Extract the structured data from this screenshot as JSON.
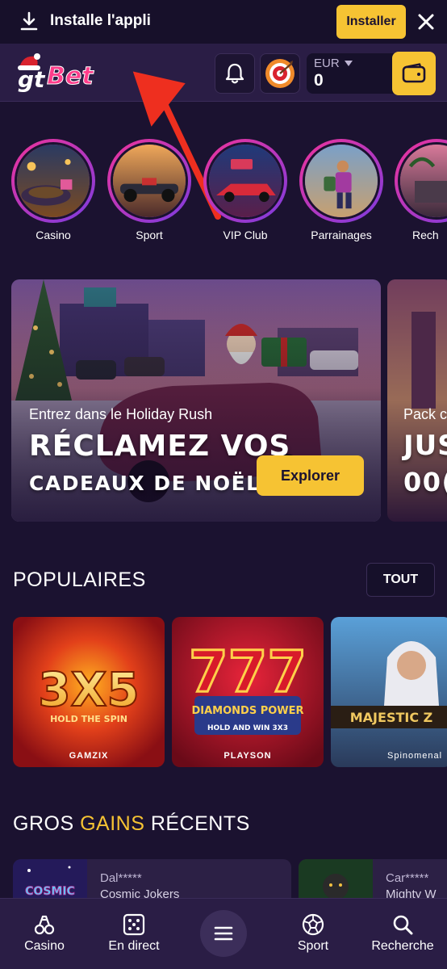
{
  "app_banner": {
    "text": "Installe l'appli",
    "install_label": "Installer",
    "icons": [
      "download-icon",
      "close-icon"
    ]
  },
  "header": {
    "logo_text": "gtBet",
    "currency": "EUR",
    "balance": "0",
    "icons": [
      "bell-icon",
      "target-icon",
      "wallet-icon"
    ]
  },
  "stories": [
    {
      "label": "Casino"
    },
    {
      "label": "Sport"
    },
    {
      "label": "VIP Club"
    },
    {
      "label": "Parrainages"
    },
    {
      "label": "Rech"
    }
  ],
  "promos": [
    {
      "subtitle": "Entrez dans le Holiday Rush",
      "headline1": "RÉCLAMEZ VOS",
      "headline2": "CADEAUX DE NOËL",
      "button": "Explorer"
    },
    {
      "subtitle": "Pack c",
      "headline1": "JUS",
      "headline2": "00("
    }
  ],
  "popular": {
    "title": "POPULAIRES",
    "all_label": "TOUT",
    "games": [
      {
        "title_line1": "3X5",
        "title_line2": "HOLD THE SPIN",
        "provider": "GAMZIX"
      },
      {
        "title_line1": "777",
        "title_line2": "DIAMONDS POWER",
        "title_line3": "HOLD AND WIN 3X3",
        "provider": "PLAYSON"
      },
      {
        "title_line1": "MAJESTIC Z",
        "provider": "Spinomenal"
      }
    ]
  },
  "recent_wins": {
    "title_part1": "GROS",
    "title_accent": "GAINS",
    "title_part2": "RÉCENTS",
    "items": [
      {
        "user": "Dal*****",
        "game": "Cosmic Jokers",
        "thumb_text": "COSMIC"
      },
      {
        "user": "Car*****",
        "game": "Mighty W"
      }
    ]
  },
  "bottom_nav": {
    "items": [
      {
        "label": "Casino",
        "icon": "casino-icon"
      },
      {
        "label": "En direct",
        "icon": "dice-icon"
      },
      {
        "label": "Sport",
        "icon": "soccer-ball-icon"
      },
      {
        "label": "Recherche",
        "icon": "search-icon"
      }
    ],
    "menu_icon": "menu-icon"
  },
  "colors": {
    "background": "#1b1230",
    "accent": "#f6c333",
    "story_ring": "#f0339a",
    "nav_bg": "#2a1d45"
  }
}
